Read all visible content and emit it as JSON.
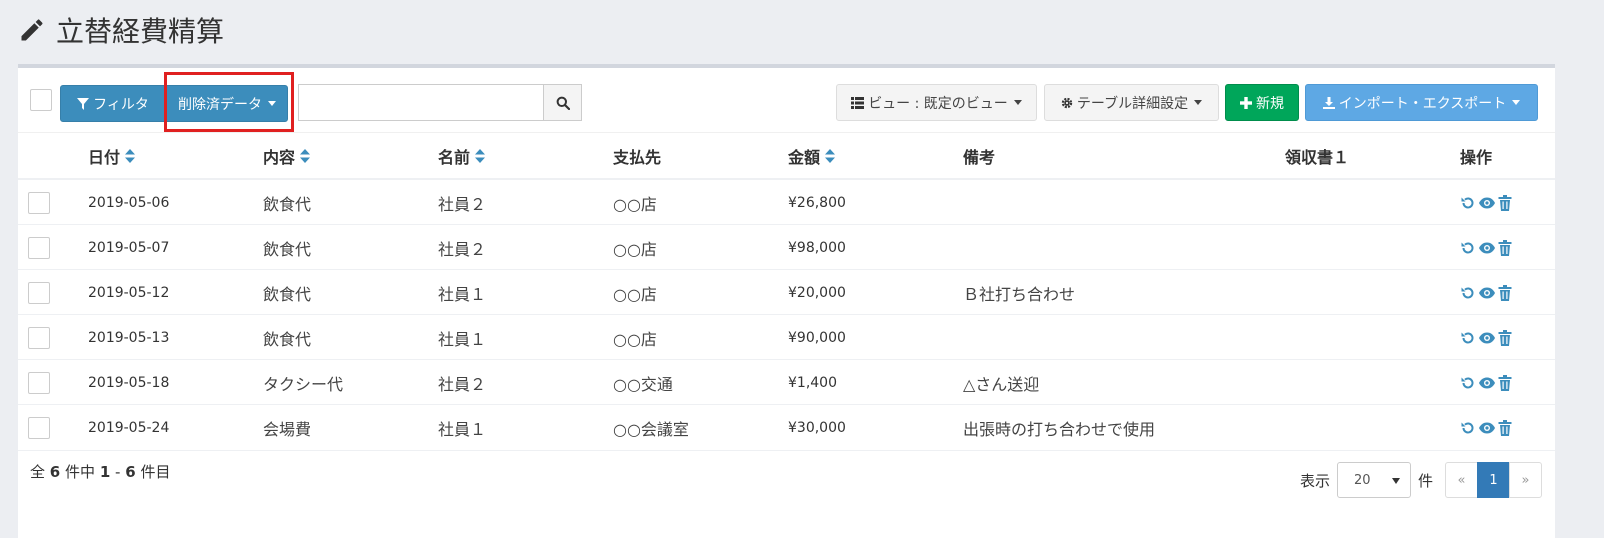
{
  "page": {
    "title": "立替経費精算"
  },
  "toolbar": {
    "filter_label": "フィルタ",
    "deleted_label": "削除済データ",
    "search_placeholder": "",
    "view_label": "ビュー : 既定のビュー",
    "table_settings_label": "テーブル詳細設定",
    "new_label": "新規",
    "import_export_label": "インポート・エクスポート"
  },
  "table": {
    "headers": {
      "date": "日付",
      "item": "内容",
      "name": "名前",
      "payee": "支払先",
      "amount": "金額",
      "memo": "備考",
      "receipt": "領収書１",
      "ops": "操作"
    },
    "rows": [
      {
        "date": "2019-05-06",
        "item": "飲食代",
        "name": "社員２",
        "payee": "○○店",
        "amount": "¥26,800",
        "memo": ""
      },
      {
        "date": "2019-05-07",
        "item": "飲食代",
        "name": "社員２",
        "payee": "○○店",
        "amount": "¥98,000",
        "memo": ""
      },
      {
        "date": "2019-05-12",
        "item": "飲食代",
        "name": "社員１",
        "payee": "○○店",
        "amount": "¥20,000",
        "memo": "Ｂ社打ち合わせ"
      },
      {
        "date": "2019-05-13",
        "item": "飲食代",
        "name": "社員１",
        "payee": "○○店",
        "amount": "¥90,000",
        "memo": ""
      },
      {
        "date": "2019-05-18",
        "item": "タクシー代",
        "name": "社員２",
        "payee": "○○交通",
        "amount": "¥1,400",
        "memo": "△さん送迎"
      },
      {
        "date": "2019-05-24",
        "item": "会場費",
        "name": "社員１",
        "payee": "○○会議室",
        "amount": "¥30,000",
        "memo": "出張時の打ち合わせで使用"
      }
    ]
  },
  "footer": {
    "summary_prefix": "全",
    "total": "6",
    "summary_mid": "件中",
    "range_start": "1",
    "range_sep": "-",
    "range_end": "6",
    "summary_suffix": "件目",
    "display_label": "表示",
    "per_page": "20",
    "per_page_unit": "件",
    "pagination": {
      "prev": "«",
      "current": "1",
      "next": "»"
    }
  },
  "colors": {
    "primary": "#3c8dbc",
    "success": "#00a65a",
    "info": "#5ea8e4",
    "highlight": "#e02020",
    "action_icon": "#3c8dbc"
  },
  "icons": [
    "pencil-icon",
    "filter-icon",
    "search-icon",
    "list-icon",
    "gear-icon",
    "plus-icon",
    "download-icon",
    "sort-icon",
    "restore-icon",
    "eye-icon",
    "trash-icon"
  ]
}
